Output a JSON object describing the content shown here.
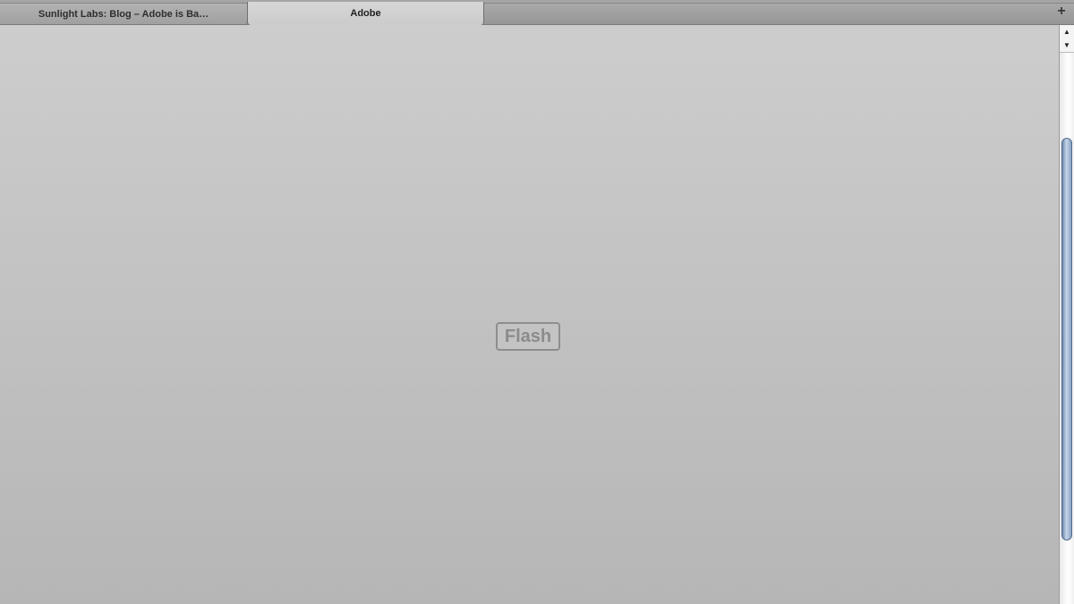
{
  "tabs": [
    {
      "label": "Sunlight Labs: Blog – Adobe is Ba…",
      "active": false
    },
    {
      "label": "Adobe",
      "active": true
    }
  ],
  "new_tab": {
    "icon": "plus-icon",
    "glyph": "+"
  },
  "content": {
    "placeholder_label": "Flash"
  },
  "scrollbar": {
    "up_glyph": "▲",
    "down_glyph": "▼",
    "thumb_color": "#8aa2c2"
  },
  "colors": {
    "content_top": "#cdcdcd",
    "content_bottom": "#b6b6b6",
    "tabbar": "#9c9c9c"
  }
}
